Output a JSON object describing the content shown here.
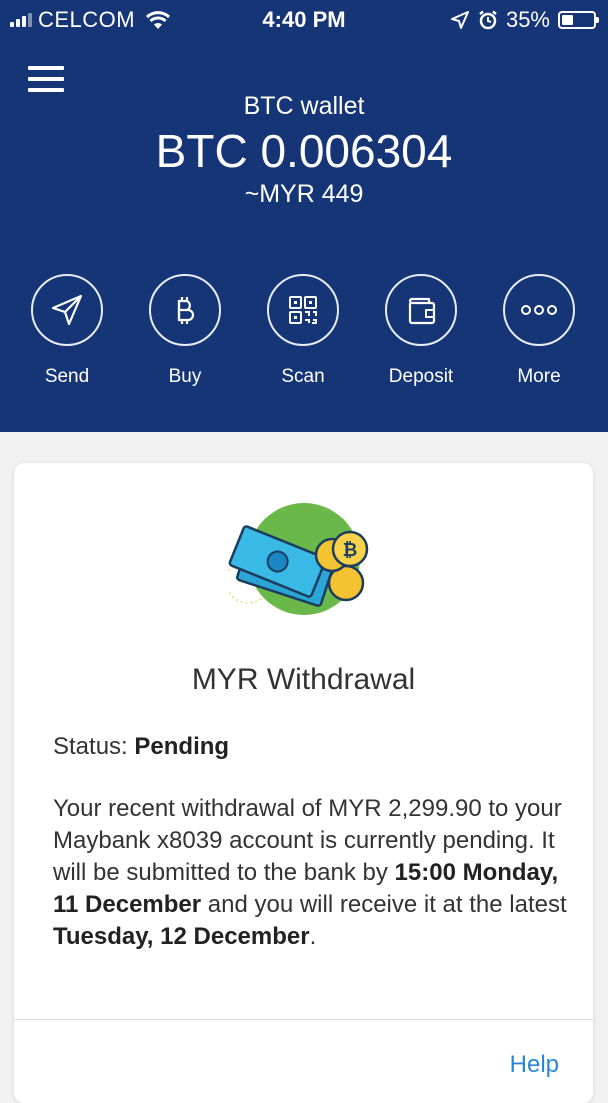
{
  "status_bar": {
    "carrier": "CELCOM",
    "time": "4:40 PM",
    "battery_percent": "35%",
    "battery_level": 0.35,
    "icons": [
      "signal-icon",
      "wifi-icon",
      "location-arrow-icon",
      "alarm-icon",
      "battery-icon"
    ]
  },
  "header": {
    "menu_icon": "hamburger-menu-icon",
    "wallet_title": "BTC wallet",
    "balance": "BTC 0.006304",
    "fiat_value": "~MYR 449",
    "background_color": "#163576"
  },
  "actions": [
    {
      "label": "Send",
      "icon": "send-icon"
    },
    {
      "label": "Buy",
      "icon": "bitcoin-icon"
    },
    {
      "label": "Scan",
      "icon": "qr-code-icon"
    },
    {
      "label": "Deposit",
      "icon": "wallet-icon"
    },
    {
      "label": "More",
      "icon": "more-icon"
    }
  ],
  "card": {
    "illustration": "money-coins-illustration",
    "title": "MYR Withdrawal",
    "status_label": "Status:",
    "status_value": "Pending",
    "desc_part1": "Your recent withdrawal of MYR 2,299.90 to your Maybank x8039 account  is currently pending. It will be submitted to the bank by ",
    "desc_bold1": "15:00 Monday, 11 December",
    "desc_part2": " and you will receive it at the latest ",
    "desc_bold2": "Tuesday, 12 December",
    "desc_part3": ".",
    "help_label": "Help",
    "link_color": "#2b86d8"
  }
}
